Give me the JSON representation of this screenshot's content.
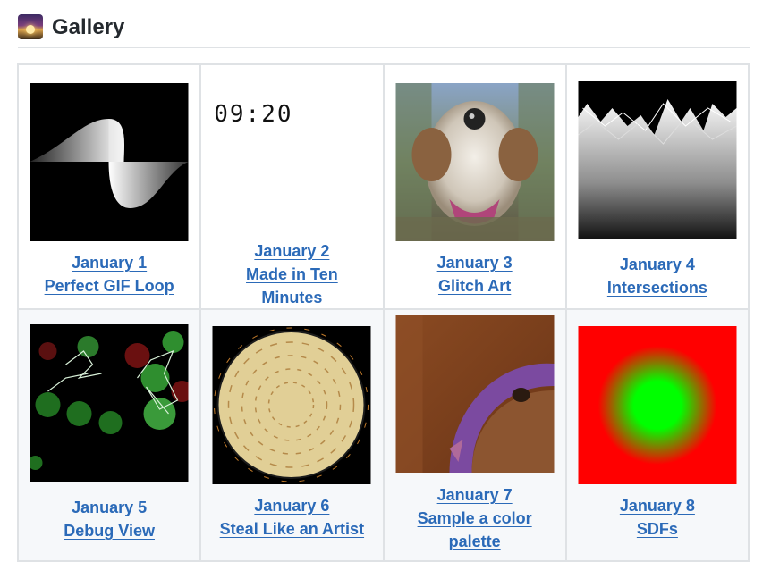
{
  "heading": {
    "icon": "sunset-photo-icon",
    "title": "Gallery"
  },
  "gallery": {
    "items": [
      {
        "date": "January 1",
        "title": "Perfect GIF Loop",
        "thumb": "perfect-gif-loop-thumbnail"
      },
      {
        "date": "January 2",
        "title": "Made in Ten Minutes",
        "title_lines": [
          "Made in Ten",
          "Minutes"
        ],
        "thumb": "clock-text",
        "clock": "09:20"
      },
      {
        "date": "January 3",
        "title": "Glitch Art",
        "thumb": "glitch-art-thumbnail"
      },
      {
        "date": "January 4",
        "title": "Intersections",
        "thumb": "intersections-thumbnail"
      },
      {
        "date": "January 5",
        "title": "Debug View",
        "thumb": "debug-view-thumbnail"
      },
      {
        "date": "January 6",
        "title": "Steal Like an Artist",
        "thumb": "steal-like-an-artist-thumbnail"
      },
      {
        "date": "January 7",
        "title": "Sample a color palette",
        "title_lines": [
          "Sample a color",
          "palette"
        ],
        "thumb": "sample-color-palette-thumbnail"
      },
      {
        "date": "January 8",
        "title": "SDFs",
        "thumb": "sdfs-thumbnail"
      }
    ]
  },
  "colors": {
    "link": "#2b6ab8",
    "border": "#dfe2e5",
    "row_alt": "#f6f8fa"
  }
}
